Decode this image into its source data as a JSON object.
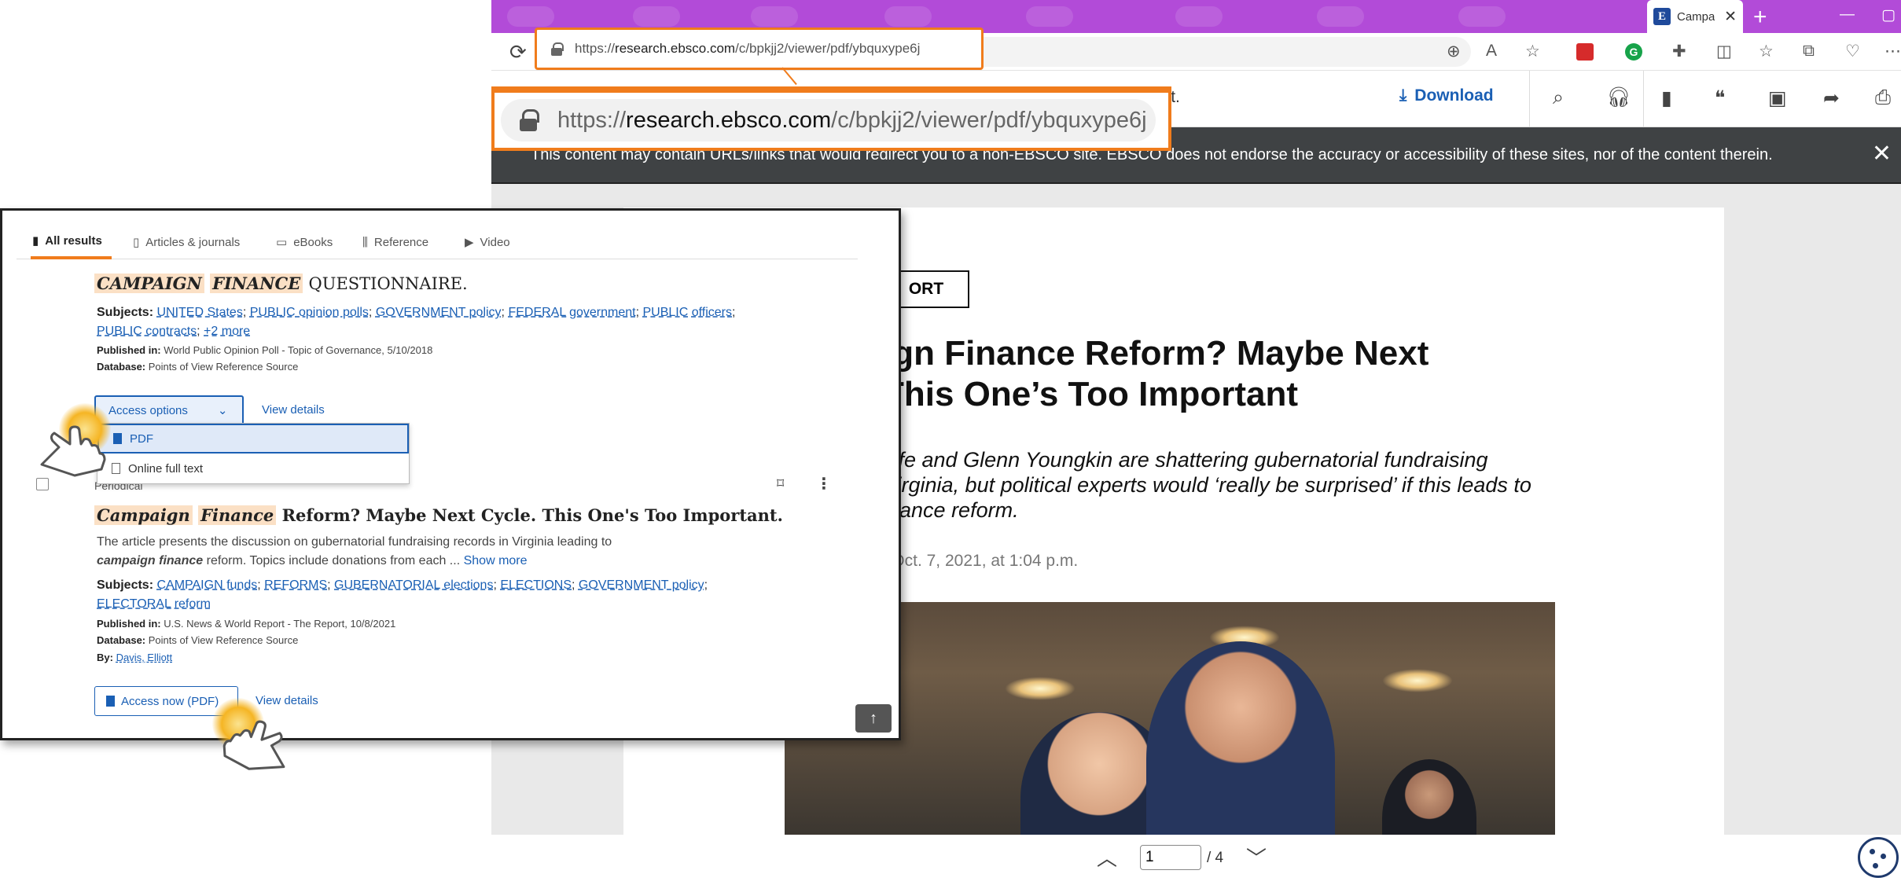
{
  "browser": {
    "tab_title": "Campa",
    "favicon_letter": "E",
    "url_prefix": "https://",
    "url_domain": "research.ebsco.com",
    "url_path": "/c/bpkjj2/viewer/pdf/ybquxype6j"
  },
  "toolbar": {
    "title_fragment": "tant.",
    "download_label": "Download"
  },
  "notice": {
    "text": "This content may contain URLs/links that would redirect you to a non-EBSCO site. EBSCO does not endorse the accuracy or accessibility of these sites, nor of the content therein."
  },
  "pdf": {
    "section_label": "ORT",
    "headline": "ign Finance Reform? Maybe Next This One’s Too Important",
    "headline_line1": "ign Finance Reform? Maybe Next",
    "headline_line2": "This One’s Too Important",
    "deck_line1": "liffe and Glenn Youngkin are shattering gubernatorial fundraising",
    "deck_line2": "Virginia, but political experts would ‘really be surprised’ if this leads to",
    "deck_line3": "inance reform.",
    "date": "| Oct. 7, 2021, at 1:04 p.m."
  },
  "pager": {
    "current_page": "1",
    "total": "/ 4"
  },
  "results": {
    "tabs": [
      {
        "label": "All results",
        "icon": "book-icon"
      },
      {
        "label": "Articles & journals",
        "icon": "document-icon"
      },
      {
        "label": "eBooks",
        "icon": "ebook-icon"
      },
      {
        "label": "Reference",
        "icon": "library-icon"
      },
      {
        "label": "Video",
        "icon": "play-icon"
      }
    ],
    "record1": {
      "title_hl1": "CAMPAIGN",
      "title_hl2": "FINANCE",
      "title_rest": "QUESTIONNAIRE.",
      "subjects_label": "Subjects:",
      "subjects": [
        "UNITED States",
        "PUBLIC opinion polls",
        "GOVERNMENT policy",
        "FEDERAL government",
        "PUBLIC",
        "officers",
        "PUBLIC contracts"
      ],
      "more_subjects": "+2 more",
      "published_label": "Published in:",
      "published": "World Public Opinion Poll - Topic of Governance, 5/10/2018",
      "database_label": "Database:",
      "database": "Points of View Reference Source",
      "access_options": "Access options",
      "view_details": "View details",
      "dropdown": [
        "PDF",
        "Online full text"
      ]
    },
    "record2": {
      "type": "Periodical",
      "title_hl1": "Campaign",
      "title_hl2": "Finance",
      "title_rest": "Reform? Maybe Next Cycle. This One's Too Important.",
      "desc_line1": "The article presents the discussion on gubernatorial fundraising records in Virginia leading to",
      "desc_bold": "campaign finance",
      "desc_line2": "reform. Topics include donations from each ...",
      "show_more": "Show more",
      "subjects_label": "Subjects:",
      "subjects": [
        "CAMPAIGN funds",
        "REFORMS",
        "GUBERNATORIAL elections",
        "ELECTIONS",
        "GOVERNMENT policy",
        "ELECTORAL reform"
      ],
      "published_label": "Published in:",
      "published": "U.S. News & World Report - The Report, 10/8/2021",
      "database_label": "Database:",
      "database": "Points of View Reference Source",
      "by_label": "By:",
      "author": "Davis, Elliott",
      "access_now": "Access now (PDF)",
      "view_details": "View details"
    }
  },
  "colors": {
    "accent_orange": "#f07c1c",
    "tab_purple": "#b24bd8",
    "link_blue": "#1a5fb4",
    "notice_bg": "#3f4244"
  }
}
